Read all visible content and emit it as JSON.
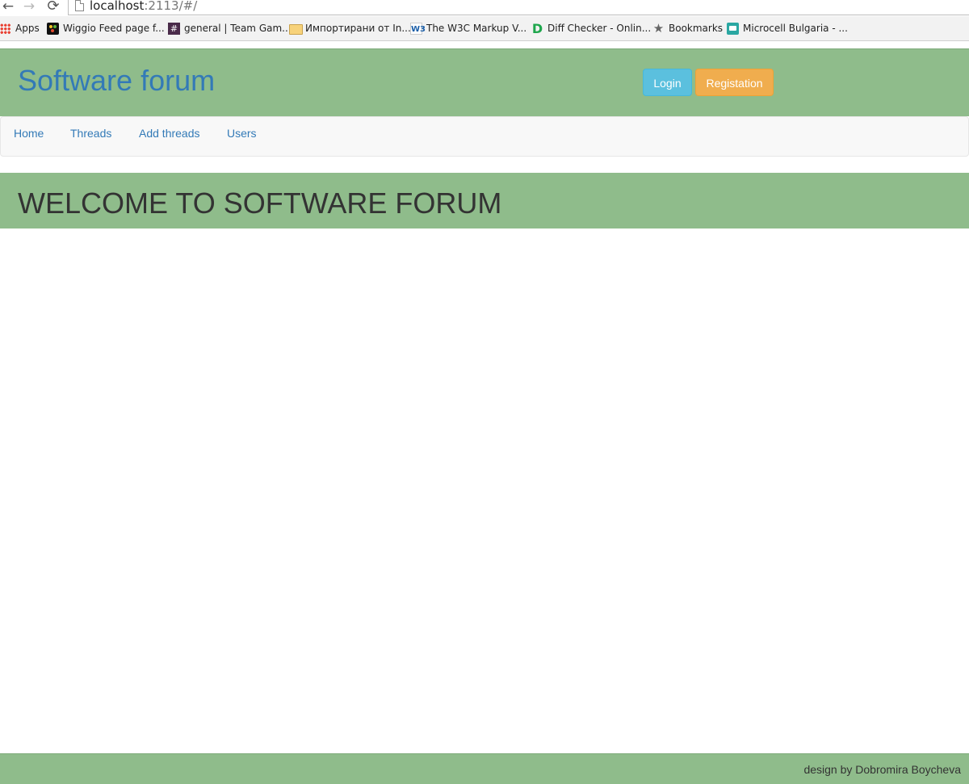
{
  "browser": {
    "url_host": "localhost",
    "url_rest": ":2113/#/",
    "bookmarks": [
      {
        "label": "Apps",
        "icon": "apps-grid-icon"
      },
      {
        "label": "Wiggio Feed page f...",
        "icon": "wiggio-icon"
      },
      {
        "label": "general | Team Gam...",
        "icon": "slack-hash-icon"
      },
      {
        "label": "Импортирани от In...",
        "icon": "folder-icon"
      },
      {
        "label": "The W3C Markup V...",
        "icon": "w3c-icon"
      },
      {
        "label": "Diff Checker - Onlin...",
        "icon": "diff-checker-icon"
      },
      {
        "label": "Bookmarks",
        "icon": "star-icon"
      },
      {
        "label": "Microcell Bulgaria - ...",
        "icon": "microcell-icon"
      }
    ]
  },
  "header": {
    "title": "Software forum",
    "login_label": "Login",
    "register_label": "Registation"
  },
  "nav": {
    "items": [
      {
        "label": "Home"
      },
      {
        "label": "Threads"
      },
      {
        "label": "Add threads"
      },
      {
        "label": "Users"
      }
    ]
  },
  "main": {
    "welcome": "WELCOME TO SOFTWARE FORUM"
  },
  "footer": {
    "credit": "design by Dobromira Boycheva"
  },
  "colors": {
    "header_bg": "#8fbc8b",
    "link": "#337ab7",
    "login_btn": "#5bc0de",
    "register_btn": "#f0ad4e"
  }
}
